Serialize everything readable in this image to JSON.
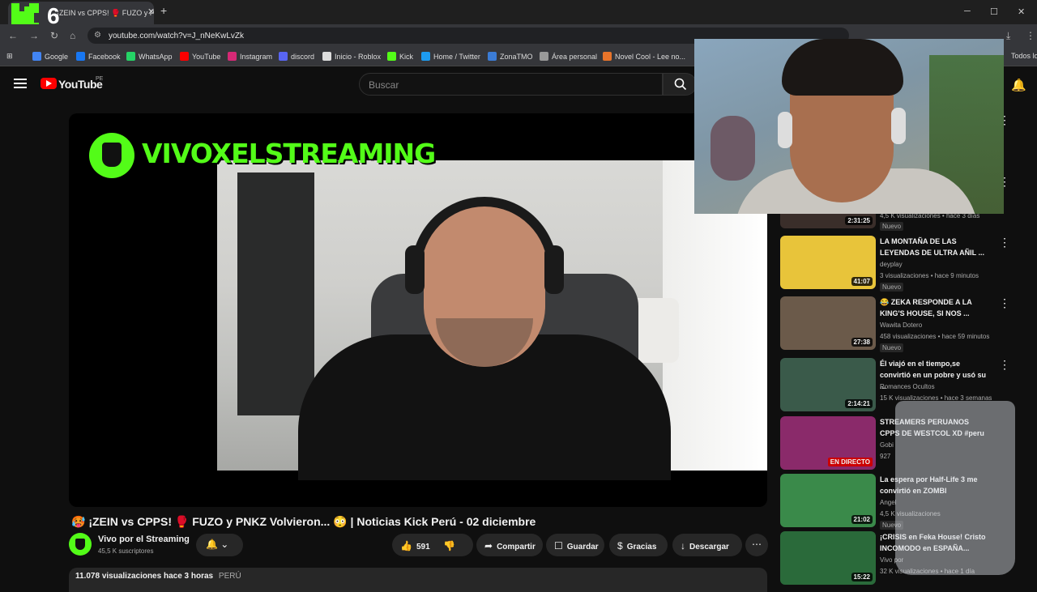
{
  "browser": {
    "tab_title": "¡ZEIN vs CPPS! 🥊 FUZO y P",
    "tab_close": "✕",
    "new_tab": "+",
    "url": "youtube.com/watch?v=J_nNeKwLvZk",
    "overlay_number": "6",
    "bookmarks": [
      "Google",
      "Facebook",
      "WhatsApp",
      "YouTube",
      "Instagram",
      "discord",
      "Inicio - Roblox",
      "Kick",
      "Home / Twitter",
      "ZonaTMO",
      "Área personal",
      "Novel Cool - Lee no...",
      "Todos los"
    ]
  },
  "youtube": {
    "logo_text": "YouTube",
    "country": "PE",
    "search_placeholder": "Buscar"
  },
  "player": {
    "overlay_title": "VIVOXELSTREAMING"
  },
  "video": {
    "title": "🥵 ¡ZEIN vs CPPS! 🥊 FUZO y PNKZ Volvieron... 😳 | Noticias Kick Perú - 02 diciembre",
    "channel": "Vivo por el Streaming",
    "subscribers": "45,5 K suscriptores",
    "likes": "591",
    "share": "Compartir",
    "save": "Guardar",
    "thanks": "Gracias",
    "download": "Descargar",
    "views": "11.078 visualizaciones",
    "date": "hace 3 horas",
    "country_tag": "PERÚ"
  },
  "sidebar": {
    "partial": {
      "duration": "2:31:25",
      "meta": "4,5 K visualizaciones • hace 3 días",
      "badge": "Nuevo"
    },
    "items": [
      {
        "title": "LA MONTAÑA DE LAS LEYENDAS DE ULTRA AÑIL ...",
        "channel": "deyplay",
        "meta": "3 visualizaciones • hace 9 minutos",
        "duration": "41:07",
        "badge": "Nuevo",
        "color": "#e8c43a"
      },
      {
        "title": "😂 ZEKA RESPONDE A LA KING'S HOUSE, SI NOS ...",
        "channel": "Wawita Dotero",
        "meta": "458 visualizaciones • hace 59 minutos",
        "duration": "27:38",
        "badge": "Nuevo",
        "color": "#6b5a4a"
      },
      {
        "title": "Él viajó en el tiempo,se convirtió en un pobre y usó su ...",
        "channel": "Romances Ocultos",
        "meta": "15 K visualizaciones • hace 3 semanas",
        "duration": "2:14:21",
        "color": "#3a5a4a"
      },
      {
        "title": "STREAMERS PERUANOS CPPS DE WESTCOL XD #peru",
        "channel": "Gobi",
        "meta": "927",
        "live": "EN DIRECTO",
        "color": "#8a2a6a"
      },
      {
        "title": "La espera por Half-Life 3 me convirtió en ZOMBI",
        "channel": "Angel",
        "meta": "4,5 K visualizaciones",
        "duration": "21:02",
        "badge": "Nuevo",
        "color": "#3a8a4a"
      },
      {
        "title": "¡CRISIS en Feka House! Cristo INCOMODO en ESPAÑA...",
        "channel": "Vivo por",
        "meta": "32 K visualizaciones • hace 1 día",
        "duration": "15:22",
        "color": "#2a6a3a"
      }
    ]
  }
}
